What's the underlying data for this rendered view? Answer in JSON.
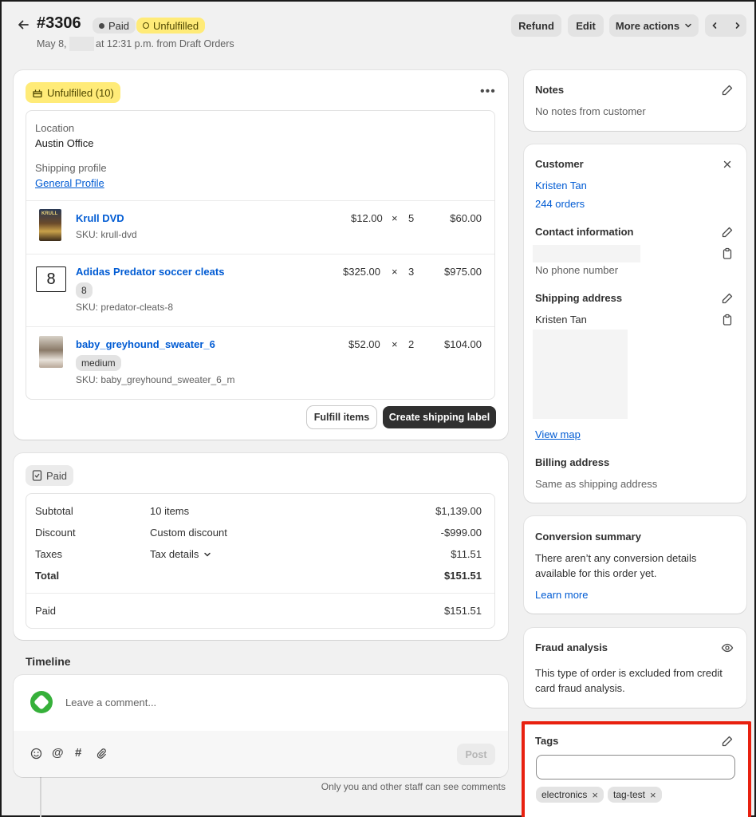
{
  "header": {
    "order_number": "#3306",
    "paid_badge": "Paid",
    "unfulfilled_badge": "Unfulfilled",
    "date_prefix": "May 8,",
    "date_suffix": "at 12:31 p.m. from Draft Orders",
    "refund_label": "Refund",
    "edit_label": "Edit",
    "more_actions_label": "More actions"
  },
  "fulfillment": {
    "badge": "Unfulfilled (10)",
    "location_label": "Location",
    "location_value": "Austin Office",
    "shipping_profile_label": "Shipping profile",
    "shipping_profile_value": "General Profile",
    "items": [
      {
        "name": "Krull DVD",
        "variant": "",
        "sku": "SKU: krull-dvd",
        "price": "$12.00",
        "times": "×",
        "qty": "5",
        "total": "$60.00"
      },
      {
        "name": "Adidas Predator soccer cleats",
        "variant": "8",
        "sku": "SKU: predator-cleats-8",
        "price": "$325.00",
        "times": "×",
        "qty": "3",
        "total": "$975.00",
        "thumb_text": "8"
      },
      {
        "name": "baby_greyhound_sweater_6",
        "variant": "medium",
        "sku": "SKU: baby_greyhound_sweater_6_m",
        "price": "$52.00",
        "times": "×",
        "qty": "2",
        "total": "$104.00"
      }
    ],
    "fulfill_button": "Fulfill items",
    "shipping_label_button": "Create shipping label"
  },
  "payment": {
    "badge": "Paid",
    "rows": [
      {
        "label": "Subtotal",
        "detail": "10 items",
        "amount": "$1,139.00"
      },
      {
        "label": "Discount",
        "detail": "Custom discount",
        "amount": "-$999.00"
      },
      {
        "label": "Taxes",
        "detail": "Tax details",
        "amount": "$11.51"
      },
      {
        "label": "Total",
        "detail": "",
        "amount": "$151.51"
      }
    ],
    "paid_label": "Paid",
    "paid_amount": "$151.51"
  },
  "timeline": {
    "title": "Timeline",
    "comment_placeholder": "Leave a comment...",
    "post_button": "Post",
    "footnote": "Only you and other staff can see comments"
  },
  "notes": {
    "title": "Notes",
    "text": "No notes from customer"
  },
  "customer": {
    "title": "Customer",
    "name": "Kristen Tan",
    "orders": "244 orders",
    "contact_title": "Contact information",
    "no_phone": "No phone number",
    "shipping_title": "Shipping address",
    "shipping_name": "Kristen Tan",
    "view_map": "View map",
    "billing_title": "Billing address",
    "billing_text": "Same as shipping address"
  },
  "conversion": {
    "title": "Conversion summary",
    "text_line1": "There aren’t any conversion details",
    "text_line2": "available for this order yet.",
    "learn_more": "Learn more"
  },
  "fraud": {
    "title": "Fraud analysis",
    "text_line1": "This type of order is excluded from credit",
    "text_line2": "card fraud analysis."
  },
  "tags": {
    "title": "Tags",
    "input_value": "",
    "items": [
      "electronics",
      "tag-test"
    ]
  },
  "colors": {
    "highlight_border": "#e8200f",
    "unfulfilled_badge_bg": "#ffeb78",
    "primary_button_bg": "#303030",
    "link": "#005bd3"
  }
}
